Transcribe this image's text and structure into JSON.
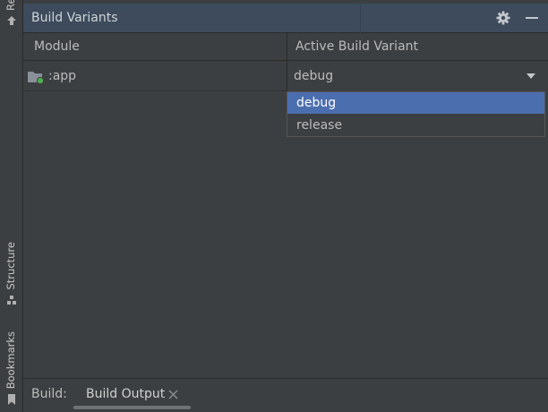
{
  "side_strip": {
    "top_tab": "Re",
    "structure_tab": "Structure",
    "bookmarks_tab": "Bookmarks"
  },
  "panel": {
    "title": "Build Variants"
  },
  "table": {
    "columns": [
      "Module",
      "Active Build Variant"
    ],
    "rows": [
      {
        "module": ":app",
        "variant": "debug"
      }
    ]
  },
  "dropdown": {
    "options": [
      "debug",
      "release"
    ],
    "selected": "debug"
  },
  "bottom_bar": {
    "label": "Build:",
    "tab": "Build Output"
  },
  "colors": {
    "background": "#3c3f41",
    "header": "#3d4b5c",
    "selection": "#4b6eaf",
    "status_dot": "#4caf50"
  },
  "icons": [
    "gear-icon",
    "minimize-icon",
    "folder-icon",
    "chevron-down-icon",
    "close-icon",
    "structure-icon",
    "bookmark-icon",
    "tool-icon"
  ]
}
